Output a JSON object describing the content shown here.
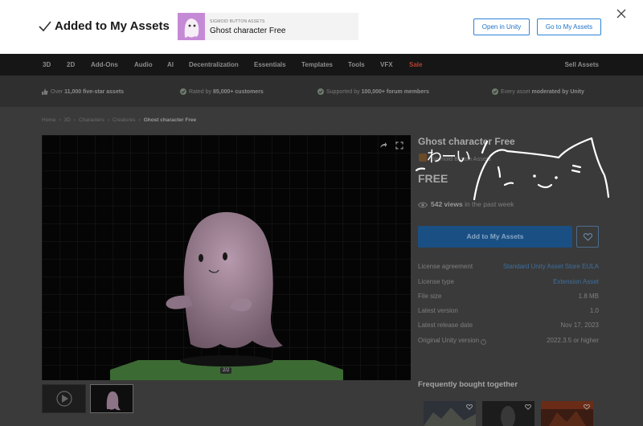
{
  "banner": {
    "added_text": "Added to My Assets",
    "asset_publisher": "SIGMOID BUTTON ASSETS",
    "asset_name": "Ghost character Free",
    "open_in_unity": "Open in Unity",
    "go_to_my_assets": "Go to My Assets",
    "icons": [
      "check-icon",
      "close-icon"
    ]
  },
  "nav": {
    "items": [
      "3D",
      "2D",
      "Add-Ons",
      "Audio",
      "AI",
      "Decentralization",
      "Essentials",
      "Templates",
      "Tools",
      "VFX",
      "Sale"
    ],
    "sell": "Sell Assets",
    "sale_color": "#b3402e"
  },
  "stats": [
    {
      "prefix": "Over ",
      "bold": "11,000 five-star assets",
      "suffix": "",
      "icon": "thumbs-up-icon"
    },
    {
      "prefix": "Rated by ",
      "bold": "85,000+ customers",
      "suffix": "",
      "icon": "check-circle-icon"
    },
    {
      "prefix": "Supported by ",
      "bold": "100,000+ forum members",
      "suffix": "",
      "icon": "check-circle-icon"
    },
    {
      "prefix": "Every asset ",
      "bold": "moderated by Unity",
      "suffix": "",
      "icon": "check-circle-icon"
    }
  ],
  "breadcrumb": [
    "Home",
    "3D",
    "Characters",
    "Creatures",
    "Ghost character Free"
  ],
  "viewer": {
    "counter": "2/2",
    "icons": [
      "share-icon",
      "fullscreen-icon"
    ]
  },
  "product": {
    "title": "Ghost character Free",
    "publisher": "Sigmoid Button Assets",
    "price": "FREE",
    "views_bold": "542 views",
    "views_rest": "in the past week",
    "add_button": "Add to My Assets",
    "accent": "#1a4f83"
  },
  "specs": [
    {
      "label": "License agreement",
      "value": "Standard Unity Asset Store EULA",
      "link": true
    },
    {
      "label": "License type",
      "value": "Extension Asset",
      "link": true
    },
    {
      "label": "File size",
      "value": "1.8 MB",
      "link": false
    },
    {
      "label": "Latest version",
      "value": "1.0",
      "link": false
    },
    {
      "label": "Latest release date",
      "value": "Nov 17, 2023",
      "link": false
    },
    {
      "label": "Original Unity version",
      "value": "2022.3.5 or higher",
      "link": false
    }
  ],
  "frequently_bought": {
    "title": "Frequently bought together"
  },
  "overlay": {
    "handwritten_text": "わーい"
  }
}
